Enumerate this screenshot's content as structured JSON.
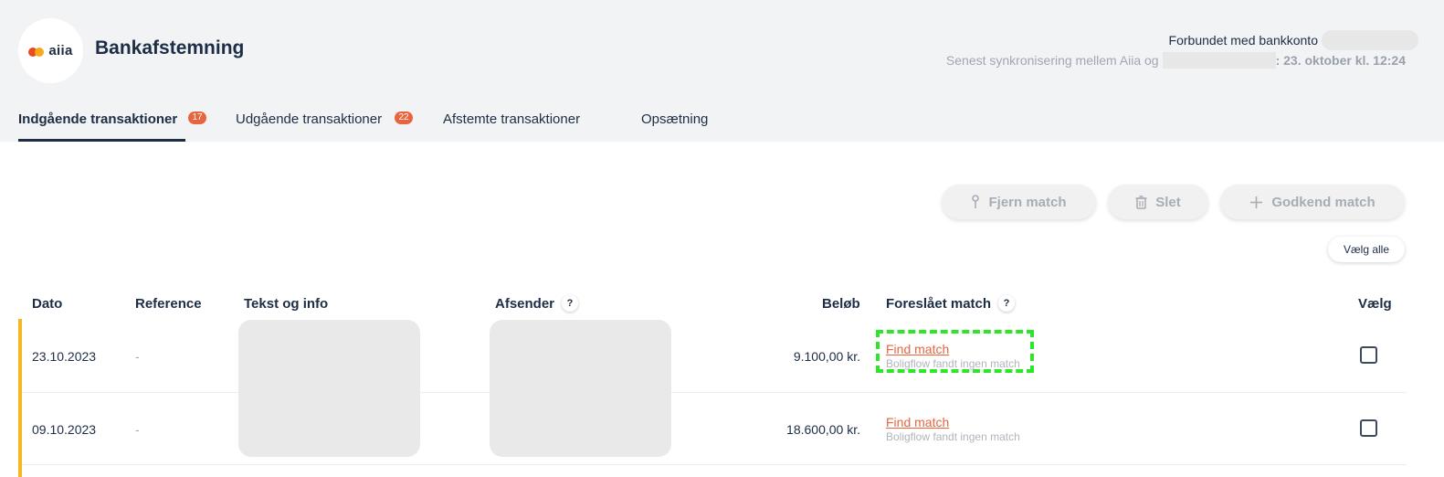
{
  "header": {
    "logo_text": "aiia",
    "title": "Bankafstemning",
    "bank_connected_label": "Forbundet med bankkonto",
    "sync_label": "Senest synkronisering mellem Aiia og",
    "sync_date": ": 23. oktober kl. 12:24"
  },
  "tabs": [
    {
      "label": "Indgående transaktioner",
      "badge": "17",
      "active": true
    },
    {
      "label": "Udgående transaktioner",
      "badge": "22",
      "active": false
    },
    {
      "label": "Afstemte transaktioner",
      "badge": "",
      "active": false
    },
    {
      "label": "Opsætning",
      "badge": "",
      "active": false
    }
  ],
  "toolbar": {
    "remove_match": "Fjern match",
    "delete": "Slet",
    "approve_match": "Godkend match",
    "select_all": "Vælg alle"
  },
  "table": {
    "headers": {
      "date": "Dato",
      "reference": "Reference",
      "text_info": "Tekst og info",
      "sender": "Afsender",
      "amount": "Beløb",
      "suggested_match": "Foreslået match",
      "select": "Vælg",
      "help": "?"
    },
    "rows": [
      {
        "date": "23.10.2023",
        "reference": "-",
        "amount": "9.100,00 kr.",
        "match_link": "Find match",
        "match_note": "Boligflow fandt ingen match",
        "selected": false
      },
      {
        "date": "09.10.2023",
        "reference": "-",
        "amount": "18.600,00 kr.",
        "match_link": "Find match",
        "match_note": "Boligflow fandt ingen match",
        "selected": false
      }
    ]
  },
  "colors": {
    "accent": "#e8643f",
    "row_indicator": "#f5b820",
    "highlight": "#2fe52a",
    "text_primary": "#1d2d45"
  }
}
